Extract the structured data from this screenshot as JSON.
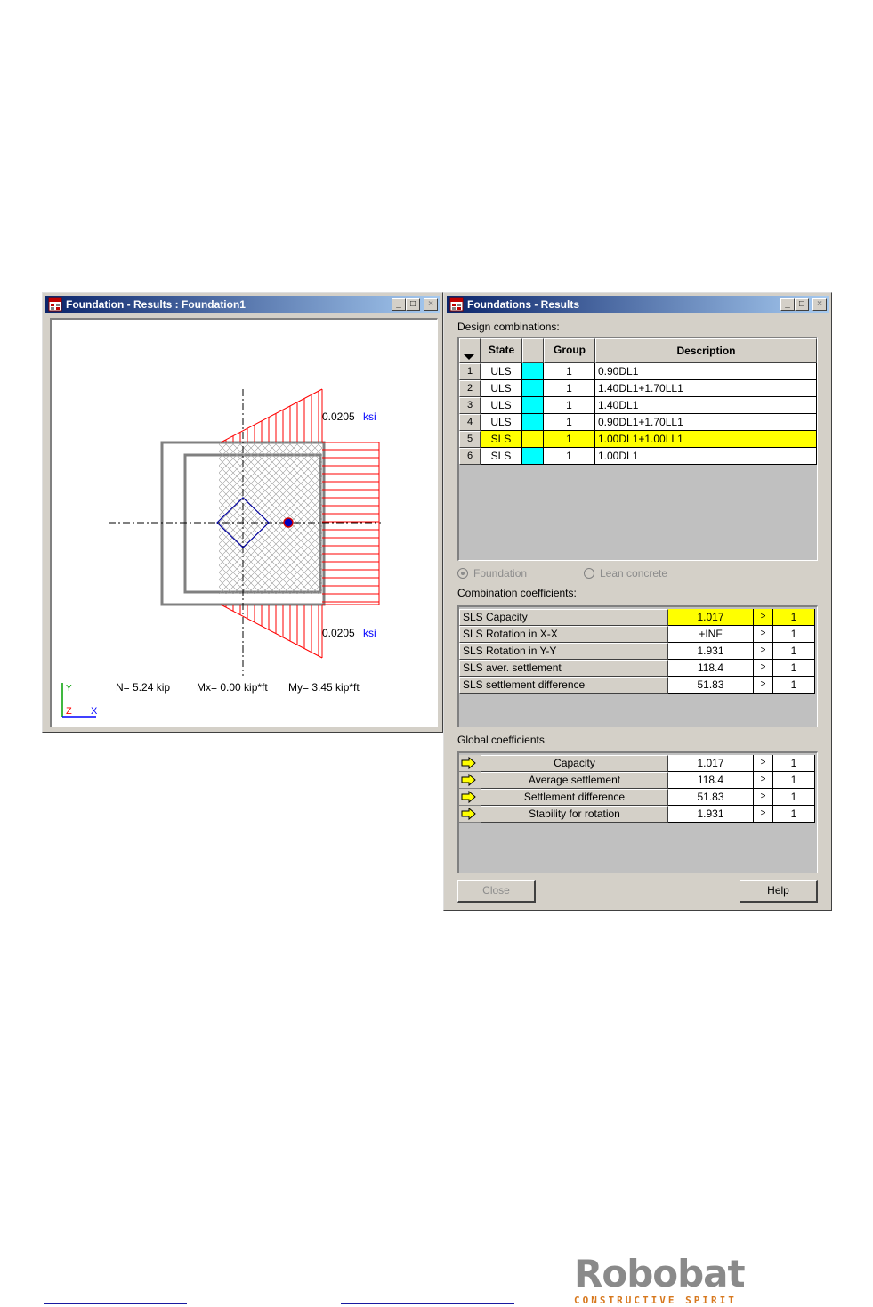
{
  "left_window": {
    "title": "Foundation - Results : Foundation1",
    "stress_top": "0.0205",
    "stress_top_unit": "ksi",
    "stress_bottom": "0.0205",
    "stress_bottom_unit": "ksi",
    "axis_y": "Y",
    "axis_z": "Z",
    "axis_x": "X",
    "n_value": "N= 5.24 kip",
    "mx_value": "Mx= 0.00 kip*ft",
    "my_value": "My= 3.45 kip*ft"
  },
  "right_window": {
    "title": "Foundations - Results",
    "design_label": "Design combinations:",
    "columns": {
      "state": "State",
      "group": "Group",
      "description": "Description"
    },
    "combinations": [
      {
        "num": "1",
        "state": "ULS",
        "group": "1",
        "description": "0.90DL1"
      },
      {
        "num": "2",
        "state": "ULS",
        "group": "1",
        "description": "1.40DL1+1.70LL1"
      },
      {
        "num": "3",
        "state": "ULS",
        "group": "1",
        "description": "1.40DL1"
      },
      {
        "num": "4",
        "state": "ULS",
        "group": "1",
        "description": "0.90DL1+1.70LL1"
      },
      {
        "num": "5",
        "state": "SLS",
        "group": "1",
        "description": "1.00DL1+1.00LL1"
      },
      {
        "num": "6",
        "state": "SLS",
        "group": "1",
        "description": "1.00DL1"
      }
    ],
    "radio_foundation": "Foundation",
    "radio_lean": "Lean concrete",
    "combination_label": "Combination coefficients:",
    "combination_coeffs": [
      {
        "name": "SLS Capacity",
        "value": "1.017",
        "op": ">",
        "limit": "1"
      },
      {
        "name": "SLS Rotation in X-X",
        "value": "+INF",
        "op": ">",
        "limit": "1"
      },
      {
        "name": "SLS Rotation in Y-Y",
        "value": "1.931",
        "op": ">",
        "limit": "1"
      },
      {
        "name": "SLS aver. settlement",
        "value": "118.4",
        "op": ">",
        "limit": "1"
      },
      {
        "name": "SLS settlement difference",
        "value": "51.83",
        "op": ">",
        "limit": "1"
      }
    ],
    "global_label": "Global coefficients",
    "global_coeffs": [
      {
        "name": "Capacity",
        "value": "1.017",
        "op": ">",
        "limit": "1"
      },
      {
        "name": "Average settlement",
        "value": "118.4",
        "op": ">",
        "limit": "1"
      },
      {
        "name": "Settlement difference",
        "value": "51.83",
        "op": ">",
        "limit": "1"
      },
      {
        "name": "Stability for rotation",
        "value": "1.931",
        "op": ">",
        "limit": "1"
      }
    ],
    "close_label": "Close",
    "help_label": "Help"
  },
  "footer": {
    "logo_text": "Robobat",
    "logo_tagline": "CONSTRUCTIVE SPIRIT"
  },
  "colors": {
    "selected_row": "#ffff00",
    "state_swatch": "#00ffff",
    "pressure_diagram": "#ff0000",
    "title_gradient_start": "#0a246a"
  }
}
